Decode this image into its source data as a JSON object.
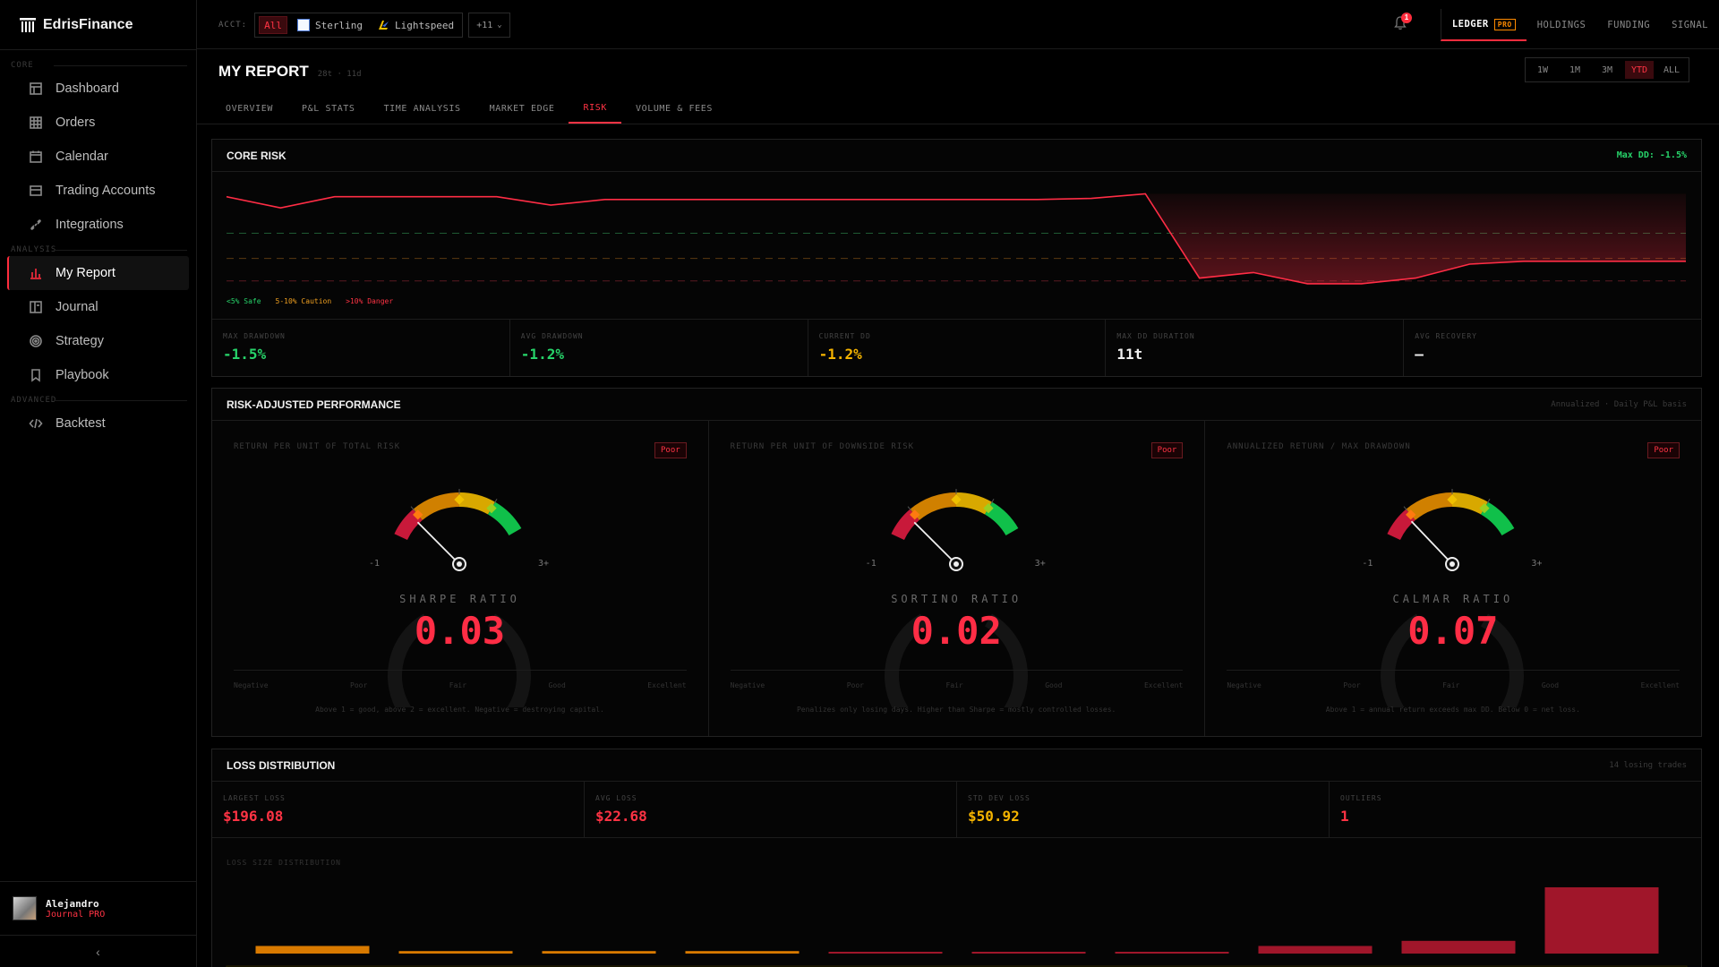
{
  "app": {
    "brand": "EdrisFinance"
  },
  "sidebar": {
    "sections": [
      {
        "label": "CORE",
        "items": [
          {
            "label": "Dashboard",
            "icon": "dashboard-icon"
          },
          {
            "label": "Orders",
            "icon": "grid-icon"
          },
          {
            "label": "Calendar",
            "icon": "calendar-icon"
          },
          {
            "label": "Trading Accounts",
            "icon": "accounts-icon"
          },
          {
            "label": "Integrations",
            "icon": "link-icon"
          }
        ]
      },
      {
        "label": "ANALYSIS",
        "items": [
          {
            "label": "My Report",
            "icon": "bar-chart-icon",
            "active": true
          },
          {
            "label": "Journal",
            "icon": "journal-icon"
          },
          {
            "label": "Strategy",
            "icon": "target-icon"
          },
          {
            "label": "Playbook",
            "icon": "bookmark-icon"
          }
        ]
      },
      {
        "label": "ADVANCED",
        "items": [
          {
            "label": "Backtest",
            "icon": "code-icon"
          }
        ]
      }
    ],
    "user": {
      "name": "Alejandro",
      "plan": "Journal PRO"
    }
  },
  "topbar": {
    "acct_label": "ACCT:",
    "accounts": [
      {
        "label": "All",
        "active": true
      },
      {
        "label": "Sterling"
      },
      {
        "label": "Lightspeed"
      }
    ],
    "more": "+11",
    "notifications": "1",
    "tabs": [
      {
        "label": "LEDGER",
        "badge": "PRO",
        "active": true
      },
      {
        "label": "HOLDINGS"
      },
      {
        "label": "FUNDING"
      },
      {
        "label": "SIGNAL"
      }
    ]
  },
  "report": {
    "title": "MY REPORT",
    "meta": "28t · 11d",
    "ranges": [
      "1W",
      "1M",
      "3M",
      "YTD",
      "ALL"
    ],
    "active_range": "YTD",
    "subtabs": [
      "OVERVIEW",
      "P&L STATS",
      "TIME ANALYSIS",
      "MARKET EDGE",
      "RISK",
      "VOLUME & FEES"
    ],
    "active_subtab": "RISK"
  },
  "core_risk": {
    "title": "CORE RISK",
    "max_dd_note": "Max DD: -1.5%",
    "legend": [
      {
        "label": "<5% Safe",
        "color": "#27d46a"
      },
      {
        "label": "5-10% Caution",
        "color": "#f0a020"
      },
      {
        "label": ">10% Danger",
        "color": "#ff3344"
      }
    ],
    "stats": [
      {
        "label": "MAX DRAWDOWN",
        "value": "-1.5%",
        "color": "#27d46a"
      },
      {
        "label": "AVG DRAWDOWN",
        "value": "-1.2%",
        "color": "#27d46a"
      },
      {
        "label": "CURRENT DD",
        "value": "-1.2%",
        "color": "#f5b400"
      },
      {
        "label": "MAX DD DURATION",
        "value": "11t",
        "color": "#f0f0f0"
      },
      {
        "label": "AVG RECOVERY",
        "value": "—",
        "color": "#f0f0f0"
      }
    ],
    "chart_data": {
      "type": "area",
      "y": [
        -0.05,
        -0.25,
        -0.05,
        -0.05,
        -0.05,
        -0.05,
        -0.2,
        -0.1,
        -0.1,
        -0.1,
        -0.1,
        -0.1,
        -0.1,
        -0.1,
        -0.1,
        -0.1,
        -0.08,
        0,
        -1.5,
        -1.4,
        -1.6,
        -1.6,
        -1.5,
        -1.25,
        -1.2,
        -1.2,
        -1.2,
        -1.2
      ],
      "ylim": [
        -2.0,
        0.2
      ]
    }
  },
  "risk_adjusted": {
    "title": "RISK-ADJUSTED PERFORMANCE",
    "note": "Annualized · Daily P&L basis",
    "gauges": [
      {
        "label": "RETURN PER UNIT OF TOTAL RISK",
        "badge": "Poor",
        "name": "SHARPE RATIO",
        "value": 0.03,
        "value_text": "0.03",
        "footnote": "Above 1 = good, above 2 = excellent. Negative = destroying capital."
      },
      {
        "label": "RETURN PER UNIT OF DOWNSIDE RISK",
        "badge": "Poor",
        "name": "SORTINO RATIO",
        "value": 0.02,
        "value_text": "0.02",
        "footnote": "Penalizes only losing days. Higher than Sharpe = mostly controlled losses."
      },
      {
        "label": "ANNUALIZED RETURN / MAX DRAWDOWN",
        "badge": "Poor",
        "name": "CALMAR RATIO",
        "value": 0.07,
        "value_text": "0.07",
        "footnote": "Above 1 = annual return exceeds max DD. Below 0 = net loss."
      }
    ],
    "scale": [
      "Negative",
      "Poor",
      "Fair",
      "Good",
      "Excellent"
    ],
    "min_label": "-1",
    "max_label": "3+"
  },
  "loss_distribution": {
    "title": "LOSS DISTRIBUTION",
    "note": "14 losing trades",
    "stats": [
      {
        "label": "LARGEST LOSS",
        "value": "$196.08",
        "color": "#ff3344"
      },
      {
        "label": "AVG LOSS",
        "value": "$22.68",
        "color": "#ff3344"
      },
      {
        "label": "STD DEV LOSS",
        "value": "$50.92",
        "color": "#f5b400"
      },
      {
        "label": "OUTLIERS",
        "value": "1",
        "color": "#ff3344"
      }
    ],
    "dist_label": "LOSS SIZE DISTRIBUTION",
    "chart_data": {
      "type": "bar",
      "values": [
        1.5,
        0.5,
        0.5,
        0.5,
        0.3,
        0.3,
        0.3,
        1.5,
        2.5,
        13
      ],
      "colors": [
        "#d97a00",
        "#d97a00",
        "#d97a00",
        "#d97a00",
        "#a0162a",
        "#a0162a",
        "#a0162a",
        "#a0162a",
        "#a0162a",
        "#a0162a"
      ]
    }
  }
}
